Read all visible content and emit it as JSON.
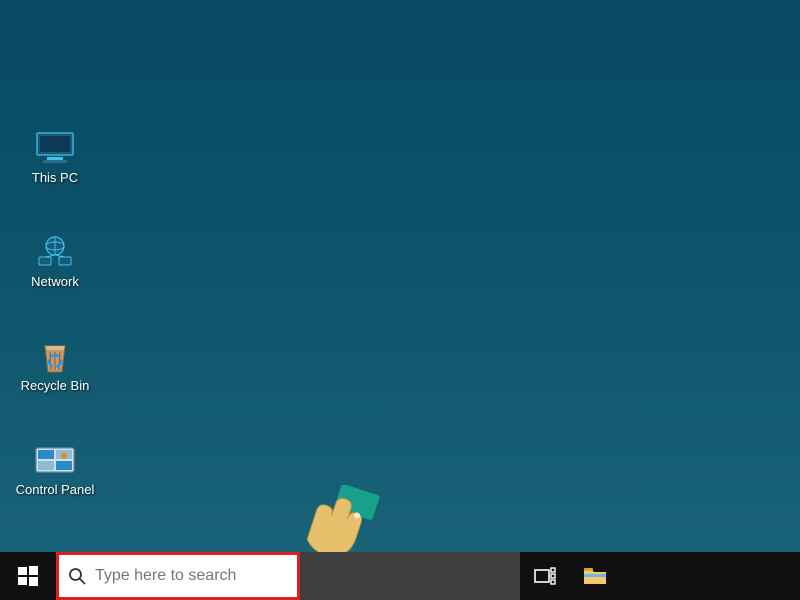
{
  "desktop": {
    "icons": [
      {
        "label": "This PC",
        "icon": "computer-icon"
      },
      {
        "label": "Network",
        "icon": "network-icon"
      },
      {
        "label": "Recycle Bin",
        "icon": "recycle-bin-icon"
      },
      {
        "label": "Control Panel",
        "icon": "control-panel-icon"
      }
    ]
  },
  "taskbar": {
    "search_placeholder": "Type here to search",
    "items": [
      {
        "name": "task-view",
        "icon": "task-view-icon"
      },
      {
        "name": "file-explorer",
        "icon": "file-explorer-icon"
      }
    ]
  },
  "annotation": {
    "highlight_target": "search-box",
    "highlight_color": "#e02020",
    "cursor_kind": "pointing-hand"
  }
}
